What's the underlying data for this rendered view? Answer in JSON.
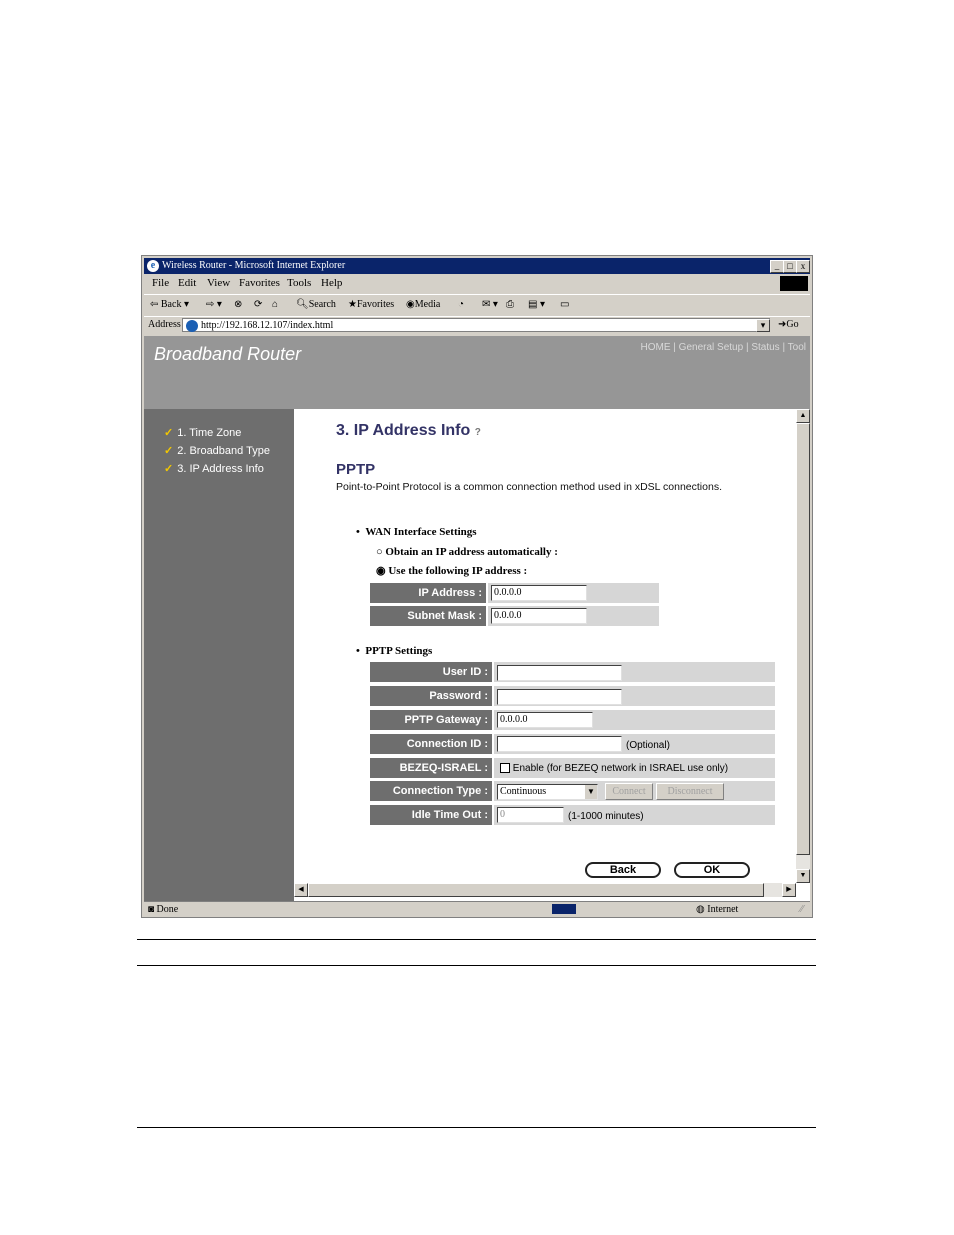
{
  "window": {
    "title": "Wireless Router - Microsoft Internet Explorer",
    "min": "_",
    "max": "□",
    "close": "x"
  },
  "menu": {
    "file": "File",
    "edit": "Edit",
    "view": "View",
    "favorites": "Favorites",
    "tools": "Tools",
    "help": "Help"
  },
  "toolbar": {
    "back": "Back",
    "search": "Search",
    "favorites": "Favorites",
    "media": "Media"
  },
  "address": {
    "label": "Address",
    "url": "http://192.168.12.107/index.html",
    "go": "Go"
  },
  "header": {
    "brand": "Broadband Router",
    "nav": "HOME | General Setup | Status | Tool"
  },
  "sidebar": {
    "items": [
      {
        "label": "1. Time Zone"
      },
      {
        "label": "2. Broadband Type"
      },
      {
        "label": "3. IP Address Info"
      }
    ]
  },
  "main": {
    "title": "3. IP Address Info",
    "section": "PPTP",
    "description": "Point-to-Point Protocol is a common connection method used in xDSL connections.",
    "wan": {
      "heading": "WAN Interface Settings",
      "opt_auto": "Obtain an IP address automatically :",
      "opt_manual": "Use the following IP address :",
      "ip_label": "IP Address :",
      "ip_value": "0.0.0.0",
      "mask_label": "Subnet Mask :",
      "mask_value": "0.0.0.0"
    },
    "pptp": {
      "heading": "PPTP Settings",
      "user_label": "User ID :",
      "user_value": "",
      "pass_label": "Password :",
      "pass_value": "",
      "gw_label": "PPTP Gateway :",
      "gw_value": "0.0.0.0",
      "conn_id_label": "Connection ID :",
      "conn_id_value": "",
      "optional": "(Optional)",
      "bezeq_label": "BEZEQ-ISRAEL :",
      "bezeq_text": "Enable (for BEZEQ network in ISRAEL use only)",
      "type_label": "Connection Type :",
      "type_value": "Continuous",
      "connect": "Connect",
      "disconnect": "Disconnect",
      "idle_label": "Idle Time Out :",
      "idle_value": "0",
      "idle_unit": "(1-1000 minutes)"
    },
    "back": "Back",
    "ok": "OK"
  },
  "status": {
    "text": "Done",
    "zone": "Internet"
  },
  "colors": {
    "titlebar": "#0a246a",
    "header": "#969696",
    "sidebar": "#6e6e6e",
    "heading": "#333366"
  }
}
